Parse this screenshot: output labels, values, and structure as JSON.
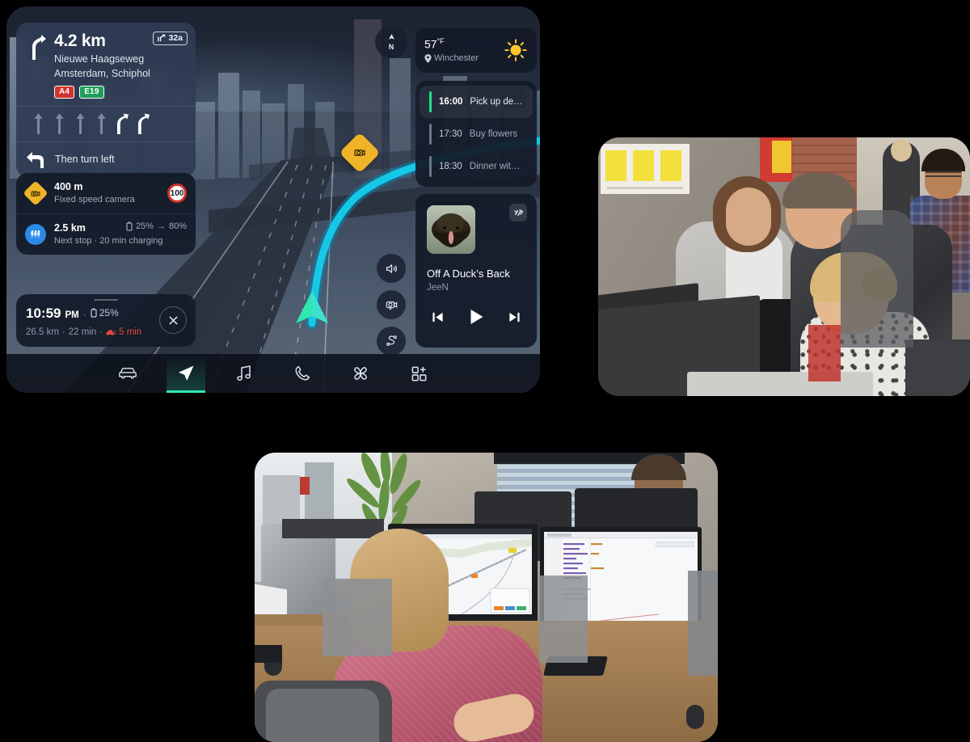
{
  "head_unit": {
    "navigation_card": {
      "distance": "4.2 km",
      "street_line1": "Nieuwe Haagseweg",
      "street_line2": "Amsterdam, Schiphol",
      "exit_number": "32a",
      "exit_icon": "motorway-exit-icon",
      "maneuver_icon": "turn-slight-right-icon",
      "road_shields": [
        {
          "label": "A4",
          "color": "#d0342c",
          "type": "motorway"
        },
        {
          "label": "E19",
          "color": "#1e9e5a",
          "type": "european-route"
        }
      ],
      "lane_guidance": [
        {
          "icon": "lane-straight-icon",
          "active": false
        },
        {
          "icon": "lane-straight-icon",
          "active": false
        },
        {
          "icon": "lane-straight-icon",
          "active": false
        },
        {
          "icon": "lane-straight-icon",
          "active": false
        },
        {
          "icon": "lane-slight-right-icon",
          "active": true
        },
        {
          "icon": "lane-slight-right-icon",
          "active": true
        }
      ],
      "then_maneuver": {
        "label": "Then turn left",
        "icon": "turn-left-icon"
      }
    },
    "alerts": [
      {
        "icon": "speed-camera-icon",
        "title": "400 m",
        "subtitle": "Fixed speed camera",
        "speed_limit": "100"
      },
      {
        "icon": "ev-charging-icon",
        "title": "2.5 km",
        "subtitle": "Next stop · 20 min charging",
        "battery_from": "25%",
        "battery_arrow": "→",
        "battery_to": "80%"
      }
    ],
    "trip_summary": {
      "eta_time": "10:59",
      "eta_ampm": "PM",
      "separator": "·",
      "battery": "25%",
      "distance": "26.5 km",
      "duration": "22 min",
      "traffic_delay": "5 min",
      "traffic_icon": "traffic-jam-icon",
      "close_label": "×"
    },
    "compass": {
      "letter": "N",
      "icon": "compass-north-icon"
    },
    "map_buttons": [
      {
        "icon": "volume-icon",
        "name": "voice-guidance-button"
      },
      {
        "icon": "report-camera-icon",
        "name": "report-camera-button"
      },
      {
        "icon": "route-overview-icon",
        "name": "route-overview-button"
      }
    ],
    "map": {
      "route_color": "#15c8e8",
      "vehicle_color": "#2ee8b0",
      "camera_pin_icon": "speed-camera-icon"
    },
    "weather": {
      "temperature": "57",
      "unit": "°F",
      "location": "Winchester",
      "location_icon": "map-pin-icon",
      "condition_icon": "sun-icon"
    },
    "calendar": [
      {
        "time": "16:00",
        "title": "Pick up delivery",
        "active": true
      },
      {
        "time": "17:30",
        "title": "Buy flowers",
        "active": false
      },
      {
        "time": "18:30",
        "title": "Dinner with Ivy",
        "active": false
      }
    ],
    "media": {
      "track_title": "Off A Duck’s Back",
      "artist": "JeeN",
      "equalizer_icon": "equalizer-icon",
      "album_art_name": "album-artwork",
      "controls": [
        {
          "icon": "previous-track-icon",
          "name": "previous-track-button"
        },
        {
          "icon": "play-icon",
          "name": "play-button"
        },
        {
          "icon": "next-track-icon",
          "name": "next-track-button"
        }
      ]
    },
    "tabbar": [
      {
        "icon": "car-icon",
        "name": "tab-vehicle",
        "active": false
      },
      {
        "icon": "navigation-arrow-icon",
        "name": "tab-navigation",
        "active": true
      },
      {
        "icon": "music-note-icon",
        "name": "tab-media",
        "active": false
      },
      {
        "icon": "phone-icon",
        "name": "tab-phone",
        "active": false
      },
      {
        "icon": "climate-fan-icon",
        "name": "tab-climate",
        "active": false
      },
      {
        "icon": "apps-grid-icon",
        "name": "tab-apps",
        "active": false
      }
    ]
  },
  "photos": [
    {
      "name": "photo-team-reviewing-monitor",
      "alt": "Four colleagues gathered around an office desk looking at a computer monitor"
    },
    {
      "name": "photo-engineer-at-workstation",
      "alt": "Woman in a pink sweater working at a multi-monitor desk showing map and code windows"
    }
  ]
}
